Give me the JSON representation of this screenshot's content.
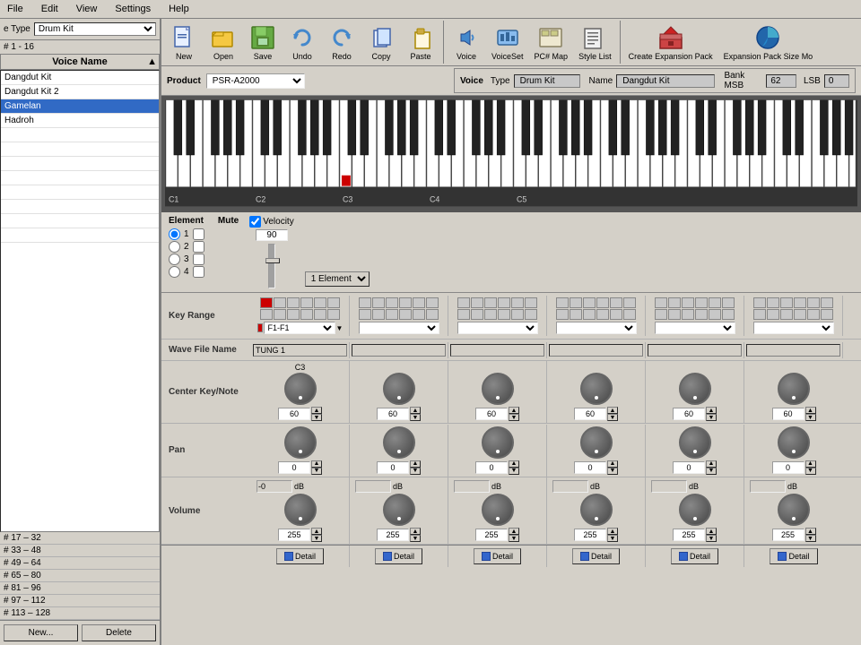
{
  "menu": {
    "items": [
      "File",
      "Edit",
      "View",
      "Settings",
      "Help"
    ]
  },
  "toolbar": {
    "buttons": [
      {
        "id": "new",
        "label": "New",
        "icon": "📄"
      },
      {
        "id": "open",
        "label": "Open",
        "icon": "📂"
      },
      {
        "id": "save",
        "label": "Save",
        "icon": "💾"
      },
      {
        "id": "undo",
        "label": "Undo",
        "icon": "↩"
      },
      {
        "id": "redo",
        "label": "Redo",
        "icon": "↪"
      },
      {
        "id": "copy",
        "label": "Copy",
        "icon": "📋"
      },
      {
        "id": "paste",
        "label": "Paste",
        "icon": "📌"
      },
      {
        "id": "voice",
        "label": "Voice",
        "icon": "🔊"
      },
      {
        "id": "voiceset",
        "label": "VoiceSet",
        "icon": "🎵"
      },
      {
        "id": "pcmap",
        "label": "PC# Map",
        "icon": "🎹"
      },
      {
        "id": "stylelist",
        "label": "Style List",
        "icon": "📃"
      },
      {
        "id": "createexp",
        "label": "Create Expansion Pack",
        "icon": "📦"
      },
      {
        "id": "expsize",
        "label": "Expansion Pack Size Mo",
        "icon": "🌐"
      }
    ]
  },
  "left_panel": {
    "type_label": "e Type",
    "type_value": "Drum Kit",
    "range_label": "# 1 - 16",
    "voice_list_header": "Voice Name",
    "voices": [
      {
        "name": "Dangdut Kit",
        "selected": false,
        "empty": false
      },
      {
        "name": "Dangdut Kit 2",
        "selected": false,
        "empty": false
      },
      {
        "name": "Gamelan",
        "selected": true,
        "empty": false
      },
      {
        "name": "Hadroh",
        "selected": false,
        "empty": false
      },
      {
        "name": "",
        "selected": false,
        "empty": true
      },
      {
        "name": "",
        "selected": false,
        "empty": true
      },
      {
        "name": "",
        "selected": false,
        "empty": true
      },
      {
        "name": "",
        "selected": false,
        "empty": true
      },
      {
        "name": "",
        "selected": false,
        "empty": true
      },
      {
        "name": "",
        "selected": false,
        "empty": true
      },
      {
        "name": "",
        "selected": false,
        "empty": true
      },
      {
        "name": "",
        "selected": false,
        "empty": true
      }
    ],
    "groups": [
      "# 17 – 32",
      "# 33 – 48",
      "# 49 – 64",
      "# 65 – 80",
      "# 81 – 96",
      "# 97 – 112",
      "# 113 – 128"
    ],
    "new_btn": "New...",
    "delete_btn": "Delete"
  },
  "product": {
    "label": "Product",
    "value": "PSR-A2000"
  },
  "voice": {
    "label": "Voice",
    "type_label": "Type",
    "type_value": "Drum Kit",
    "name_label": "Name",
    "name_value": "Dangdut Kit",
    "bank_label": "Bank MSB",
    "bank_value": "62",
    "lsb_label": "LSB",
    "lsb_value": "0"
  },
  "piano": {
    "labels": [
      "C1",
      "C2",
      "C3",
      "C4",
      "C5"
    ],
    "marker_note": "C3"
  },
  "element": {
    "label": "Element",
    "mute_label": "Mute",
    "elements": [
      {
        "num": "1",
        "checked": false
      },
      {
        "num": "2",
        "checked": false
      },
      {
        "num": "3",
        "checked": false
      },
      {
        "num": "4",
        "checked": false
      }
    ],
    "element1_selected": true,
    "velocity_label": "Velocity",
    "velocity_value": "90",
    "element_select_value": "1 Element"
  },
  "params": {
    "key_range": {
      "label": "Key Range",
      "cols": [
        {
          "active": true,
          "value": "F1-F1"
        },
        {
          "active": false,
          "value": ""
        },
        {
          "active": false,
          "value": ""
        },
        {
          "active": false,
          "value": ""
        },
        {
          "active": false,
          "value": ""
        },
        {
          "active": false,
          "value": ""
        }
      ]
    },
    "wave_file": {
      "label": "Wave File Name",
      "cols": [
        "TUNG 1",
        "",
        "",
        "",
        "",
        ""
      ]
    },
    "center_key": {
      "label": "Center Key/Note",
      "cols": [
        {
          "note": "C3",
          "value": "60"
        },
        {
          "note": "",
          "value": "60"
        },
        {
          "note": "",
          "value": "60"
        },
        {
          "note": "",
          "value": "60"
        },
        {
          "note": "",
          "value": "60"
        },
        {
          "note": "",
          "value": "60"
        }
      ]
    },
    "pan": {
      "label": "Pan",
      "cols": [
        {
          "value": "0"
        },
        {
          "value": "0"
        },
        {
          "value": "0"
        },
        {
          "value": "0"
        },
        {
          "value": "0"
        },
        {
          "value": "0"
        }
      ]
    },
    "volume": {
      "label": "Volume",
      "db_values": [
        "-0",
        "",
        "",
        "",
        "",
        ""
      ],
      "db_unit": "dB",
      "cols": [
        {
          "value": "255"
        },
        {
          "value": "255"
        },
        {
          "value": "255"
        },
        {
          "value": "255"
        },
        {
          "value": "255"
        },
        {
          "value": "255"
        }
      ]
    },
    "detail_btn_label": "Detail"
  },
  "colors": {
    "active_red": "#cc0000",
    "selected_blue": "#316ac5",
    "bg_gray": "#d4d0c8",
    "dark_bg": "#333333"
  }
}
